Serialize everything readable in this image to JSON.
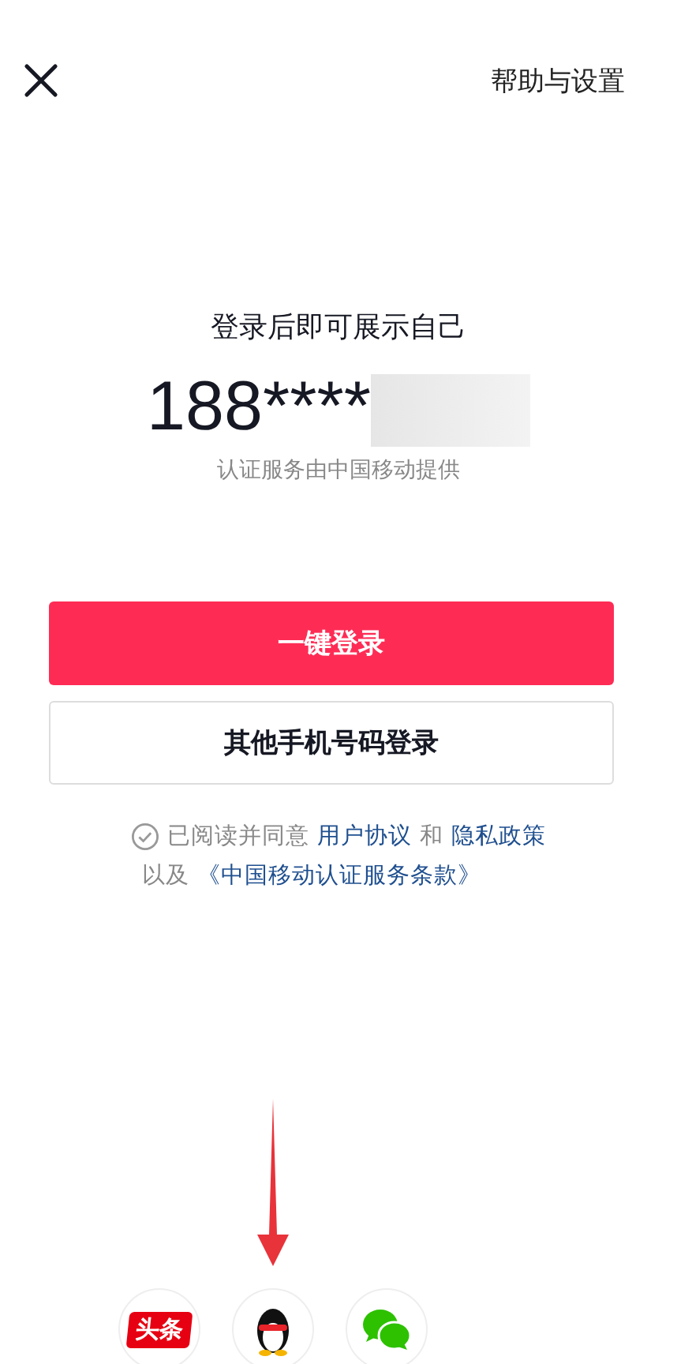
{
  "header": {
    "help_link": "帮助与设置"
  },
  "prompt": "登录后即可展示自己",
  "phone": {
    "masked": "188****",
    "redacted": true
  },
  "carrier_note": "认证服务由中国移动提供",
  "buttons": [
    {
      "label": "一键登录",
      "kind": "primary"
    },
    {
      "label": "其他手机号码登录",
      "kind": "secondary"
    }
  ],
  "agreement": {
    "checked": false,
    "lines": [
      [
        {
          "kind": "text",
          "text": "已阅读并同意"
        },
        {
          "kind": "link",
          "text": "用户协议"
        },
        {
          "kind": "text",
          "text": "和"
        },
        {
          "kind": "link",
          "text": "隐私政策"
        }
      ],
      [
        {
          "kind": "text",
          "text": "以及"
        },
        {
          "kind": "link",
          "text": "《中国移动认证服务条款》"
        }
      ]
    ]
  },
  "third_party": [
    {
      "kind": "toutiao",
      "label": "头条",
      "pointed": false
    },
    {
      "kind": "qq",
      "pointed": true
    },
    {
      "kind": "wechat",
      "pointed": false
    }
  ]
}
